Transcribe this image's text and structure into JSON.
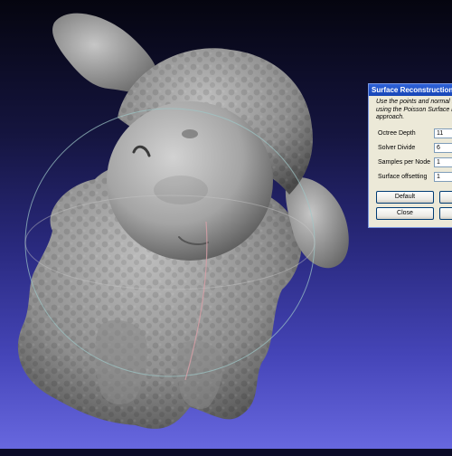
{
  "dialog": {
    "title": "Surface Reconstruction: P",
    "description": [
      "Use the points and normal to",
      "using the Poisson Surface re",
      "approach."
    ],
    "params": [
      {
        "label": "Octree Depth",
        "value": "11"
      },
      {
        "label": "Solver Divide",
        "value": "6"
      },
      {
        "label": "Samples per Node",
        "value": "1"
      },
      {
        "label": "Surface offsetting",
        "value": "1"
      }
    ],
    "buttons": {
      "default": "Default",
      "close": "Close"
    }
  },
  "colors": {
    "viewport_top": "#05050f",
    "viewport_bottom": "#6a6ae2",
    "mesh": "#9a9a9a",
    "titlebar": "#2456cc"
  },
  "icons": {
    "trackball": "trackball-rings",
    "mesh": "sheep-3d-mesh"
  }
}
